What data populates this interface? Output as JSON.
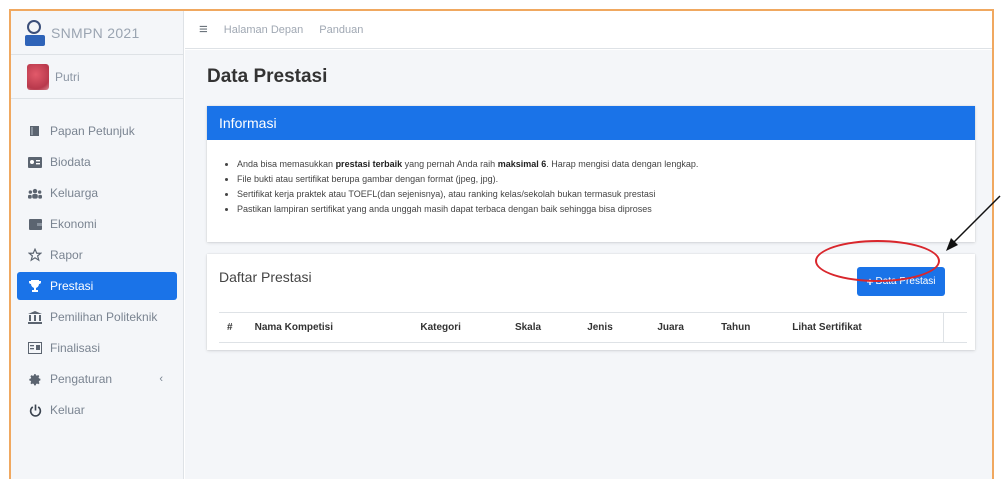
{
  "sidebar": {
    "brand": "SNMPN 2021",
    "user_name": "Putri",
    "items": [
      {
        "label": "Papan Petunjuk",
        "icon": "book-icon"
      },
      {
        "label": "Biodata",
        "icon": "id-card-icon"
      },
      {
        "label": "Keluarga",
        "icon": "users-icon"
      },
      {
        "label": "Ekonomi",
        "icon": "wallet-icon"
      },
      {
        "label": "Rapor",
        "icon": "star-icon"
      },
      {
        "label": "Prestasi",
        "icon": "trophy-icon"
      },
      {
        "label": "Pemilihan Politeknik",
        "icon": "building-icon"
      },
      {
        "label": "Finalisasi",
        "icon": "check-box-icon"
      },
      {
        "label": "Pengaturan",
        "icon": "gear-icon"
      },
      {
        "label": "Keluar",
        "icon": "power-icon"
      }
    ],
    "active_index": 5,
    "chevron": "‹"
  },
  "topbar": {
    "links": [
      "Halaman Depan",
      "Panduan"
    ]
  },
  "page": {
    "title": "Data Prestasi"
  },
  "info": {
    "heading": "Informasi",
    "bullet1": {
      "pre": "Anda bisa memasukkan ",
      "b1": "prestasi terbaik",
      "mid": " yang pernah Anda raih ",
      "b2": "maksimal 6",
      "post": ". Harap mengisi data dengan lengkap."
    },
    "bullet2": "File bukti atau sertifikat berupa gambar dengan format (jpeg, jpg).",
    "bullet3": "Sertifikat kerja praktek atau TOEFL(dan sejenisnya), atau ranking kelas/sekolah bukan termasuk prestasi",
    "bullet4": "Pastikan lampiran sertifikat yang anda unggah masih dapat terbaca dengan baik sehingga bisa diproses"
  },
  "list": {
    "title": "Daftar Prestasi",
    "add_button": "Data Prestasi",
    "columns": [
      "#",
      "Nama Kompetisi",
      "Kategori",
      "Skala",
      "Jenis",
      "Juara",
      "Tahun",
      "Lihat Sertifikat",
      ""
    ]
  },
  "colors": {
    "primary": "#1a73e8",
    "annotation": "#d9262c"
  }
}
